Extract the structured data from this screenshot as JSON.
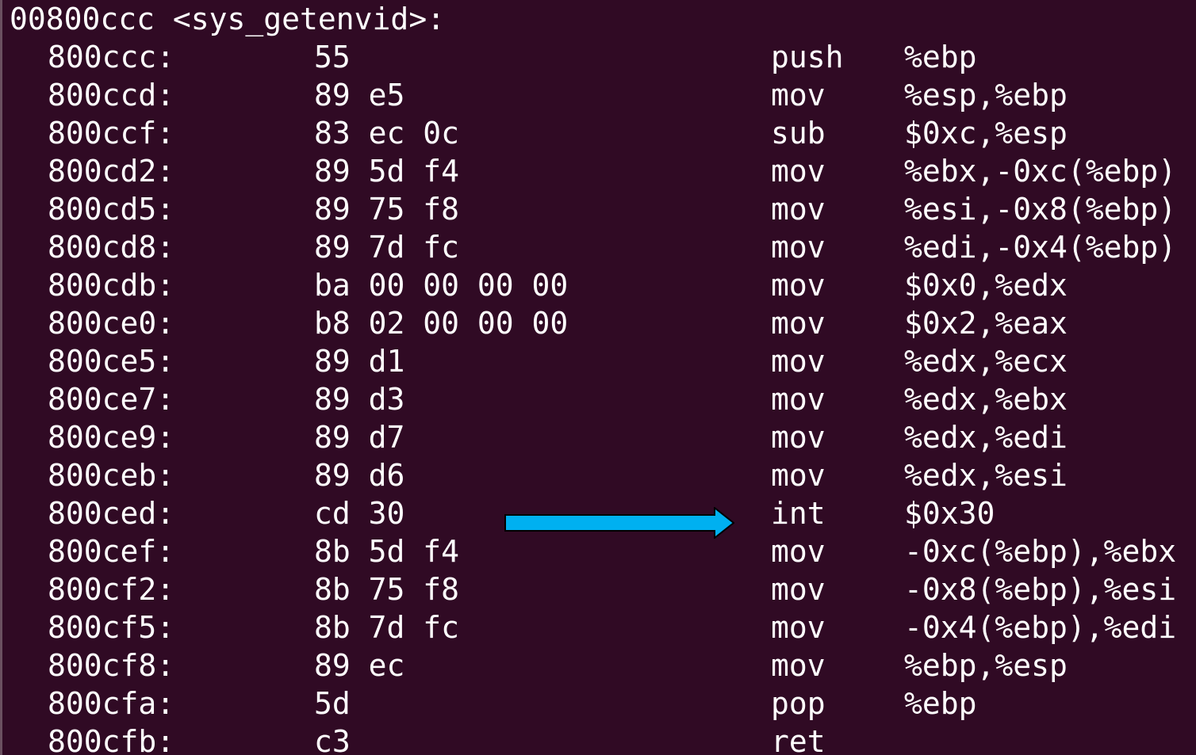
{
  "terminal": {
    "function_header": "00800ccc <sys_getenvid>:",
    "rows": [
      {
        "addr": "800ccc:",
        "bytes": "55",
        "mnemonic": "push",
        "operands": "%ebp"
      },
      {
        "addr": "800ccd:",
        "bytes": "89 e5",
        "mnemonic": "mov",
        "operands": "%esp,%ebp"
      },
      {
        "addr": "800ccf:",
        "bytes": "83 ec 0c",
        "mnemonic": "sub",
        "operands": "$0xc,%esp"
      },
      {
        "addr": "800cd2:",
        "bytes": "89 5d f4",
        "mnemonic": "mov",
        "operands": "%ebx,-0xc(%ebp)"
      },
      {
        "addr": "800cd5:",
        "bytes": "89 75 f8",
        "mnemonic": "mov",
        "operands": "%esi,-0x8(%ebp)"
      },
      {
        "addr": "800cd8:",
        "bytes": "89 7d fc",
        "mnemonic": "mov",
        "operands": "%edi,-0x4(%ebp)"
      },
      {
        "addr": "800cdb:",
        "bytes": "ba 00 00 00 00",
        "mnemonic": "mov",
        "operands": "$0x0,%edx"
      },
      {
        "addr": "800ce0:",
        "bytes": "b8 02 00 00 00",
        "mnemonic": "mov",
        "operands": "$0x2,%eax"
      },
      {
        "addr": "800ce5:",
        "bytes": "89 d1",
        "mnemonic": "mov",
        "operands": "%edx,%ecx"
      },
      {
        "addr": "800ce7:",
        "bytes": "89 d3",
        "mnemonic": "mov",
        "operands": "%edx,%ebx"
      },
      {
        "addr": "800ce9:",
        "bytes": "89 d7",
        "mnemonic": "mov",
        "operands": "%edx,%edi"
      },
      {
        "addr": "800ceb:",
        "bytes": "89 d6",
        "mnemonic": "mov",
        "operands": "%edx,%esi"
      },
      {
        "addr": "800ced:",
        "bytes": "cd 30",
        "mnemonic": "int",
        "operands": "$0x30"
      },
      {
        "addr": "800cef:",
        "bytes": "8b 5d f4",
        "mnemonic": "mov",
        "operands": "-0xc(%ebp),%ebx"
      },
      {
        "addr": "800cf2:",
        "bytes": "8b 75 f8",
        "mnemonic": "mov",
        "operands": "-0x8(%ebp),%esi"
      },
      {
        "addr": "800cf5:",
        "bytes": "8b 7d fc",
        "mnemonic": "mov",
        "operands": "-0x4(%ebp),%edi"
      },
      {
        "addr": "800cf8:",
        "bytes": "89 ec",
        "mnemonic": "mov",
        "operands": "%ebp,%esp"
      },
      {
        "addr": "800cfa:",
        "bytes": "5d",
        "mnemonic": "pop",
        "operands": "%ebp"
      },
      {
        "addr": "800cfb:",
        "bytes": "c3",
        "mnemonic": "ret",
        "operands": ""
      }
    ]
  },
  "highlight": {
    "icon": "arrow-right-icon",
    "color": "#00b0f0",
    "points_to_row": 12
  },
  "colors": {
    "background": "#300a24",
    "text": "#ffffff"
  }
}
